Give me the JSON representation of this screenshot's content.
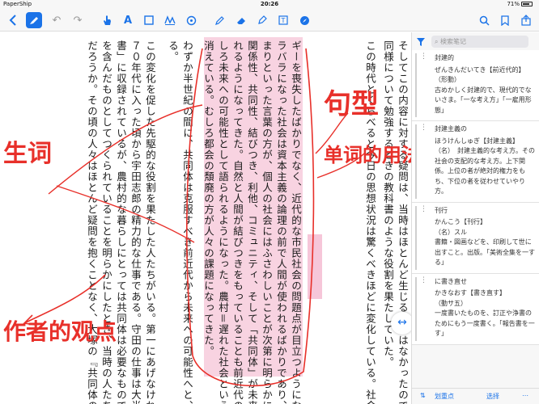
{
  "status": {
    "app": "PaperShip",
    "time": "20:26",
    "battery": "71%"
  },
  "toolbar": {
    "icons": [
      "back-icon",
      "pen-icon",
      "undo-icon",
      "redo-icon",
      "hand-icon",
      "text-color-icon",
      "rect-icon",
      "signature-icon",
      "stamp-icon",
      "highlighter-icon",
      "eraser-icon",
      "text-box-icon",
      "compass-icon",
      "search-icon",
      "bookmark-icon",
      "share-icon"
    ]
  },
  "page": {
    "columns": [
      "そしてこの内容に対する疑問は、当時はほとんど生じることはなかったのである。だからこの本は",
      "同様について勉強するときの教科書のような役割を果たしていた。",
      "この時代とくらべると今日の思想状況は驚くべきほどに変化している。社会主義が未来への主",
      "ギーを喪失したばかりでなく、近代的な市民社会の問題点が目立つようになってきた。個人",
      "ラバラになった社会は資本主義の論理の前で人間が使われるばかりであり、孤立、孤独、不安",
      "まりといった言葉の方が、個人の社会にはふさわしいことが次第に明らかになってきた。わ",
      "関係性、共同性、結びつき、利他、コミュニティ、そして「共同体」が未来へ向けた言葉とし",
      "れるようになってきた。自然と人間が結びつきをもっていることも前近代の象徴としてではな",
      "しろ未来への可能性として語られるようになった。農村＝遅れた社会という観念もしだいに",
      "消えている。むしろ都会の頽廃の方が人々の課題になってきた。",
      "わずか半世紀の間に、共同体は克服すべき前近代から未来への可能性へと、その位置を変えた",
      "る。",
      "この変化を促した先駆的な役割を果たした人たちがいる。第一にあげなければいけないのは、",
      "７０年代に入った頃から宇田志郎の精力的な仕事である。守田の仕事は大半が農文協の「人",
      "書」に収録されているが、農村的な暮らしにとっては共同体は必要なものであ",
      "を含んだものとしてつくられていることを明らかにしたとき、当時の人たちはこれほど驚いた",
      "だろうか。その頃の人々はほとんど疑問を抱くことなく、大塚の『共同体の基礎理論』を受け入れていた"
    ],
    "annotations": {
      "seishi": "生词",
      "kukei": "句型",
      "tango": "单词的用法",
      "sakusha": "作者的观点"
    }
  },
  "sidebar": {
    "search_placeholder": "検索笔记",
    "notes": [
      {
        "head": "封建的",
        "lines": [
          "ぜんきんだいてき【前近代的】",
          "（形動）",
          "古めかしく封建的で、現代的でないさま。「一な考え方」「一雇用形態」"
        ]
      },
      {
        "head": "封建主義の",
        "lines": [
          "ほうけんしゅぎ【封建主義】",
          "（名）　封建主義的な考え方。その社会の支配的な考え方。上下関係。上位の者が絶対的権力をもち、下位の者を従わせていやり方。"
        ]
      },
      {
        "head": "刊行",
        "lines": [
          "かんこう【刊行】",
          "（名）スル",
          "書籍・図画などを、印刷して世に出すこと。出版。「美術全集を一する」"
        ]
      },
      {
        "head": "に書き直せ",
        "lines": [
          "かきなおす【書き直す】",
          "（動サ五）",
          "一度書いたものを、訂正や浄書のためにもう一度書く。「報告書を一す」"
        ]
      }
    ],
    "bottom": {
      "left": "划重点",
      "right": "选择"
    }
  }
}
